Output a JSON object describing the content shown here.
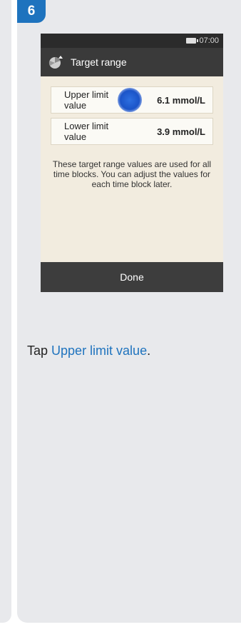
{
  "step": {
    "number": "6"
  },
  "device": {
    "status": {
      "time": "07:00"
    },
    "title": "Target range",
    "rows": [
      {
        "label": "Upper limit value",
        "value": "6.1 mmol/L"
      },
      {
        "label": "Lower limit value",
        "value": "3.9 mmol/L"
      }
    ],
    "info": "These target range values are used for all time blocks. You can adjust the values for each time block later.",
    "done_label": "Done"
  },
  "instruction": {
    "prefix": "Tap ",
    "link": "Upper limit value",
    "suffix": "."
  },
  "colors": {
    "accent": "#1e73be",
    "card_bg": "#e8e9ec",
    "screen_bg": "#f2ecdf",
    "bar_dark": "#3a3a3a"
  }
}
